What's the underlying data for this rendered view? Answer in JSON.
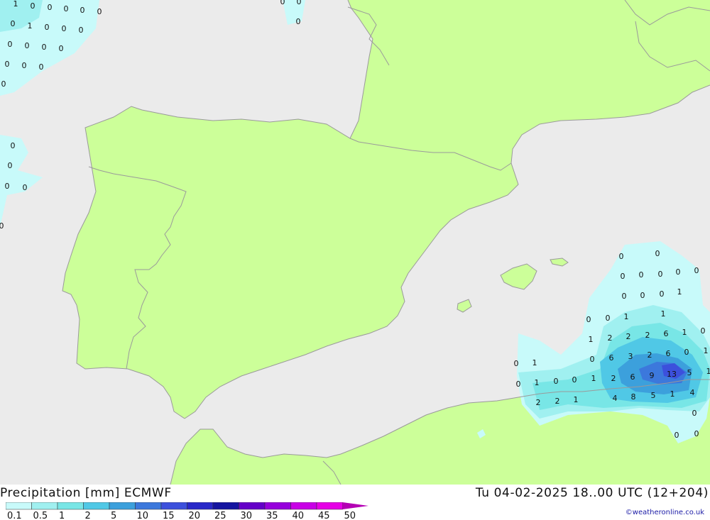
{
  "map": {
    "colors": {
      "sea": "#ebebeb",
      "land": "#ccff99",
      "border": "#9a9a9a",
      "value_text": "#111111"
    },
    "precip_values": [
      {
        "v": "1"
      },
      {
        "v": "0"
      },
      {
        "v": "0"
      },
      {
        "v": "0"
      },
      {
        "v": "0"
      },
      {
        "v": "0"
      },
      {
        "v": "0"
      },
      {
        "v": "1"
      },
      {
        "v": "0"
      },
      {
        "v": "0"
      },
      {
        "v": "0"
      },
      {
        "v": "0"
      },
      {
        "v": "0"
      },
      {
        "v": "0"
      },
      {
        "v": "0"
      },
      {
        "v": "0"
      },
      {
        "v": "0"
      },
      {
        "v": "0"
      },
      {
        "v": "0"
      },
      {
        "v": "0"
      },
      {
        "v": "0"
      },
      {
        "v": "0"
      },
      {
        "v": "0"
      },
      {
        "v": "0"
      },
      {
        "v": "0"
      },
      {
        "v": "0"
      },
      {
        "v": "0"
      },
      {
        "v": "0"
      },
      {
        "v": "0"
      },
      {
        "v": "0"
      },
      {
        "v": "0"
      },
      {
        "v": "0"
      },
      {
        "v": "0"
      },
      {
        "v": "0"
      },
      {
        "v": "0"
      },
      {
        "v": "1"
      },
      {
        "v": "0"
      },
      {
        "v": "0"
      },
      {
        "v": "0"
      },
      {
        "v": "0"
      },
      {
        "v": "1"
      },
      {
        "v": "1"
      },
      {
        "v": "1"
      },
      {
        "v": "2"
      },
      {
        "v": "2"
      },
      {
        "v": "2"
      },
      {
        "v": "6"
      },
      {
        "v": "1"
      },
      {
        "v": "0"
      },
      {
        "v": "0"
      },
      {
        "v": "6"
      },
      {
        "v": "3"
      },
      {
        "v": "2"
      },
      {
        "v": "6"
      },
      {
        "v": "0"
      },
      {
        "v": "1"
      },
      {
        "v": "0"
      },
      {
        "v": "1"
      },
      {
        "v": "2"
      },
      {
        "v": "6"
      },
      {
        "v": "9"
      },
      {
        "v": "13"
      },
      {
        "v": "5"
      },
      {
        "v": "1"
      },
      {
        "v": "0"
      },
      {
        "v": "1"
      },
      {
        "v": "0"
      },
      {
        "v": "0"
      },
      {
        "v": "1"
      },
      {
        "v": "2"
      },
      {
        "v": "2"
      },
      {
        "v": "1"
      },
      {
        "v": "4"
      },
      {
        "v": "8"
      },
      {
        "v": "5"
      },
      {
        "v": "1"
      },
      {
        "v": "4"
      },
      {
        "v": "0"
      },
      {
        "v": "0"
      },
      {
        "v": "0"
      }
    ]
  },
  "footer": {
    "title": "Precipitation [mm] ECMWF",
    "valid": "Tu 04-02-2025 18..00 UTC (12+204)",
    "credit": "©weatheronline.co.uk"
  },
  "legend": {
    "labels": [
      "0.1",
      "0.5",
      "1",
      "2",
      "5",
      "10",
      "15",
      "20",
      "25",
      "30",
      "35",
      "40",
      "45",
      "50"
    ],
    "colors": [
      "#c8fafa",
      "#a0f0f0",
      "#78e6e6",
      "#50c8e6",
      "#3ca0dc",
      "#3c78dc",
      "#3c50dc",
      "#2828c8",
      "#1414a0",
      "#6400c8",
      "#9600dc",
      "#c800e6",
      "#e600e6",
      "#b400b4"
    ]
  }
}
